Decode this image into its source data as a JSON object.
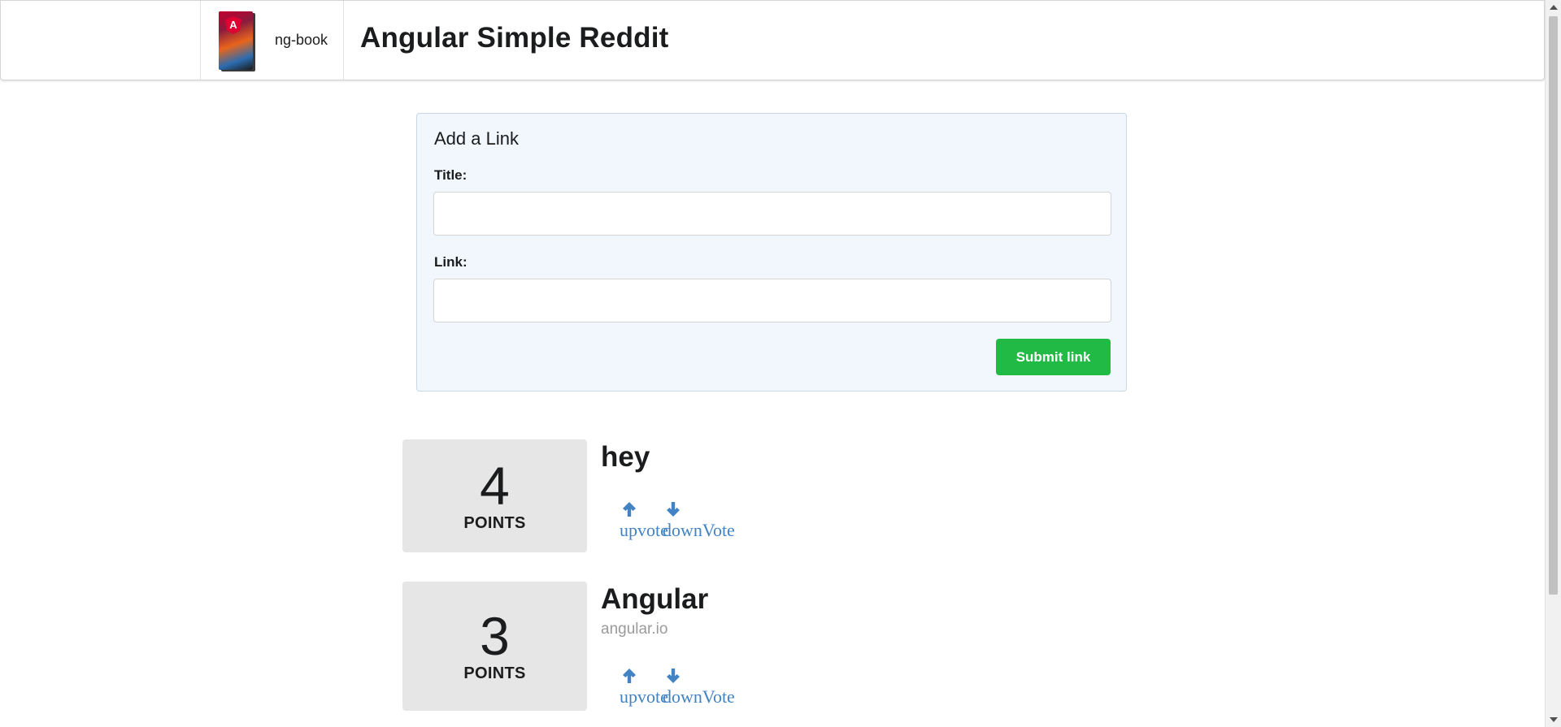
{
  "header": {
    "brand_label": "ng-book",
    "book_logo_letter": "A",
    "app_title": "Angular Simple Reddit"
  },
  "form": {
    "heading": "Add a Link",
    "title_label": "Title:",
    "title_value": "",
    "link_label": "Link:",
    "link_value": "",
    "submit_label": "Submit link",
    "background_color": "#f1f7fd",
    "submit_color": "#21ba45"
  },
  "articles": [
    {
      "votes": "4",
      "points_label": "POINTS",
      "title": "hey",
      "domain": "",
      "upvote_label": "upvote",
      "downvote_label": "downVote"
    },
    {
      "votes": "3",
      "points_label": "POINTS",
      "title": "Angular",
      "domain": "angular.io",
      "upvote_label": "upvote",
      "downvote_label": "downVote"
    }
  ],
  "icons": {
    "upvote": "arrow-up-icon",
    "downvote": "arrow-down-icon"
  },
  "colors": {
    "link": "#4183c4",
    "votes_box": "#e6e6e6"
  }
}
